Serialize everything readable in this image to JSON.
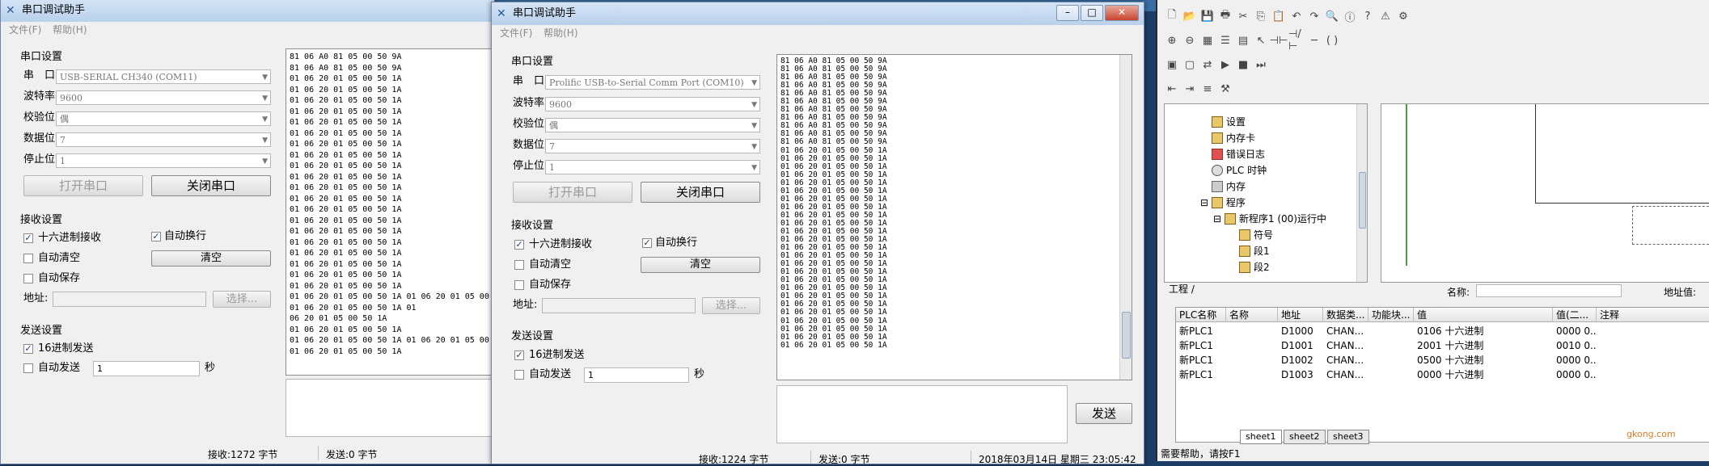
{
  "left_window": {
    "title": "串口调试助手",
    "menu": [
      "文件(F)",
      "帮助(H)"
    ],
    "serial_settings_label": "串口设置",
    "fields": [
      {
        "label": "串　口",
        "value": "USB-SERIAL CH340 (COM11)"
      },
      {
        "label": "波特率",
        "value": "9600"
      },
      {
        "label": "校验位",
        "value": "偶"
      },
      {
        "label": "数据位",
        "value": "7"
      },
      {
        "label": "停止位",
        "value": "1"
      }
    ],
    "open_button": "打开串口",
    "close_button": "关闭串口",
    "receive_settings_label": "接收设置",
    "hex_receive": "十六进制接收",
    "auto_newline": "自动换行",
    "auto_clear": "自动清空",
    "clear_button": "清空",
    "auto_save": "自动保存",
    "address_label": "地址:",
    "select_button": "选择...",
    "send_settings_label": "发送设置",
    "hex_send": "16进制发送",
    "auto_send": "自动发送",
    "auto_send_interval": "1",
    "seconds": "秒",
    "receive_text": "81 06 A0 81 05 00 50 9A\n81 06 A0 81 05 00 50 9A\n01 06 20 01 05 00 50 1A\n01 06 20 01 05 00 50 1A\n01 06 20 01 05 00 50 1A\n01 06 20 01 05 00 50 1A\n01 06 20 01 05 00 50 1A\n01 06 20 01 05 00 50 1A\n01 06 20 01 05 00 50 1A\n01 06 20 01 05 00 50 1A\n01 06 20 01 05 00 50 1A\n01 06 20 01 05 00 50 1A\n01 06 20 01 05 00 50 1A\n01 06 20 01 05 00 50 1A\n01 06 20 01 05 00 50 1A\n01 06 20 01 05 00 50 1A\n01 06 20 01 05 00 50 1A\n01 06 20 01 05 00 50 1A\n01 06 20 01 05 00 50 1A\n01 06 20 01 05 00 50 1A\n01 06 20 01 05 00 50 1A\n01 06 20 01 05 00 50 1A\n01 06 20 01 05 00 50 1A 01 06 20 01 05 00\n01 06 20 01 05 00 50 1A 01\n06 20 01 05 00 50 1A\n01 06 20 01 05 00 50 1A\n01 06 20 01 05 00 50 1A 01 06 20 01 05 00\n01 06 20 01 05 00 50 1A",
    "status_receive": "接收:1272 字节",
    "status_send": "发送:0 字节"
  },
  "right_window": {
    "title": "串口调试助手",
    "menu": [
      "文件(F)",
      "帮助(H)"
    ],
    "serial_settings_label": "串口设置",
    "fields": [
      {
        "label": "串　口",
        "value": "Prolific USB-to-Serial Comm Port (COM10)"
      },
      {
        "label": "波特率",
        "value": "9600"
      },
      {
        "label": "校验位",
        "value": "偶"
      },
      {
        "label": "数据位",
        "value": "7"
      },
      {
        "label": "停止位",
        "value": "1"
      }
    ],
    "open_button": "打开串口",
    "close_button": "关闭串口",
    "receive_settings_label": "接收设置",
    "hex_receive": "十六进制接收",
    "auto_newline": "自动换行",
    "auto_clear": "自动清空",
    "clear_button": "清空",
    "auto_save": "自动保存",
    "address_label": "地址:",
    "select_button": "选择...",
    "send_settings_label": "发送设置",
    "hex_send": "16进制发送",
    "auto_send": "自动发送",
    "auto_send_interval": "1",
    "seconds": "秒",
    "send_button": "发送",
    "receive_text": "81 06 A0 81 05 00 50 9A\n81 06 A0 81 05 00 50 9A\n81 06 A0 81 05 00 50 9A\n81 06 A0 81 05 00 50 9A\n81 06 A0 81 05 00 50 9A\n81 06 A0 81 05 00 50 9A\n81 06 A0 81 05 00 50 9A\n81 06 A0 81 05 00 50 9A\n81 06 A0 81 05 00 50 9A\n81 06 A0 81 05 00 50 9A\n81 06 A0 81 05 00 50 9A\n01 06 20 01 05 00 50 1A\n01 06 20 01 05 00 50 1A\n01 06 20 01 05 00 50 1A\n01 06 20 01 05 00 50 1A\n01 06 20 01 05 00 50 1A\n01 06 20 01 05 00 50 1A\n01 06 20 01 05 00 50 1A\n01 06 20 01 05 00 50 1A\n01 06 20 01 05 00 50 1A\n01 06 20 01 05 00 50 1A\n01 06 20 01 05 00 50 1A\n01 06 20 01 05 00 50 1A\n01 06 20 01 05 00 50 1A\n01 06 20 01 05 00 50 1A\n01 06 20 01 05 00 50 1A\n01 06 20 01 05 00 50 1A\n01 06 20 01 05 00 50 1A\n01 06 20 01 05 00 50 1A\n01 06 20 01 05 00 50 1A\n01 06 20 01 05 00 50 1A\n01 06 20 01 05 00 50 1A\n01 06 20 01 05 00 50 1A\n01 06 20 01 05 00 50 1A\n01 06 20 01 05 00 50 1A\n01 06 20 01 05 00 50 1A",
    "status_receive": "接收:1224 字节",
    "status_send": "发送:0 字节",
    "status_datetime": "2018年03月14日 星期三 23:05:42"
  },
  "plc_window": {
    "tree_items": [
      {
        "label": "设置"
      },
      {
        "label": "内存卡"
      },
      {
        "label": "错误日志"
      },
      {
        "label": "PLC 时钟"
      },
      {
        "label": "内存"
      },
      {
        "label": "程序"
      },
      {
        "label": "新程序1 (00)运行中"
      },
      {
        "label": "符号"
      },
      {
        "label": "段1"
      },
      {
        "label": "段2"
      }
    ],
    "project_tab": "工程",
    "name_label": "名称:",
    "address_value_label": "地址值:",
    "columns": [
      "PLC名称",
      "名称",
      "地址",
      "数据类...",
      "功能块...",
      "值",
      "值(二...",
      "注释"
    ],
    "rows": [
      [
        "新PLC1",
        "",
        "D1000",
        "CHAN...",
        "",
        "0106 十六进制",
        "0000 0...",
        ""
      ],
      [
        "新PLC1",
        "",
        "D1001",
        "CHAN...",
        "",
        "2001 十六进制",
        "0010 0...",
        ""
      ],
      [
        "新PLC1",
        "",
        "D1002",
        "CHAN...",
        "",
        "0500 十六进制",
        "0000 0...",
        ""
      ],
      [
        "新PLC1",
        "",
        "D1003",
        "CHAN...",
        "",
        "0000 十六进制",
        "0000 0...",
        ""
      ]
    ],
    "sheet_tabs": [
      "sheet1",
      "sheet2",
      "sheet3"
    ],
    "status_help": "需要帮助，请按F1",
    "watermark": "gkong.com"
  }
}
